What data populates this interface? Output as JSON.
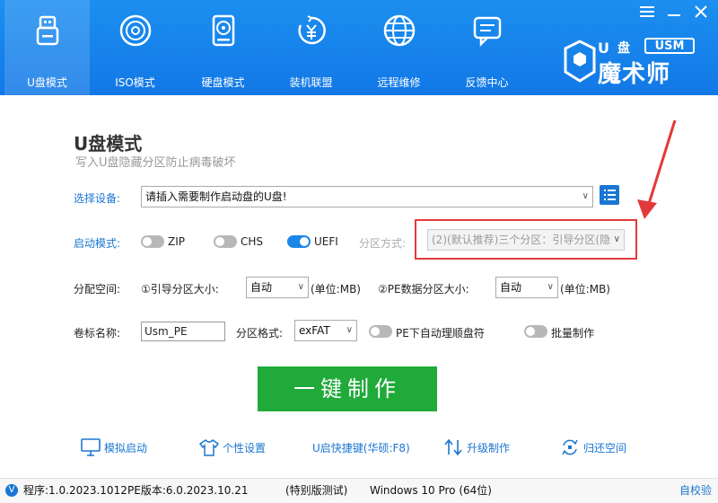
{
  "window": {
    "min_icon": "minimize-icon",
    "menu_icon": "menu-icon",
    "close_icon": "close-icon"
  },
  "nav": [
    {
      "label": "U盘模式",
      "icon": "usb-drive-icon",
      "active": true
    },
    {
      "label": "ISO模式",
      "icon": "disc-icon",
      "active": false
    },
    {
      "label": "硬盘模式",
      "icon": "hard-disk-icon",
      "active": false
    },
    {
      "label": "装机联盟",
      "icon": "yuan-coin-icon",
      "active": false
    },
    {
      "label": "远程维修",
      "icon": "globe-icon",
      "active": false
    },
    {
      "label": "反馈中心",
      "icon": "chat-icon",
      "active": false
    }
  ],
  "brand": {
    "logo_text": "U盘魔术师",
    "badge": "USM"
  },
  "main": {
    "title": "U盘模式",
    "subtitle": "写入U盘隐藏分区防止病毒破坏",
    "device_label": "选择设备:",
    "device_value": "请插入需要制作启动盘的U盘!",
    "boot_label": "启动模式:",
    "boot_options": [
      {
        "label": "ZIP",
        "on": false
      },
      {
        "label": "CHS",
        "on": false
      },
      {
        "label": "UEFI",
        "on": true
      }
    ],
    "partition_label": "分区方式:",
    "partition_value": "(2)(默认推荐)三个分区：引导分区(隐",
    "alloc_label": "分配空间:",
    "boot_part_label": "①引导分区大小:",
    "boot_part_value": "自动",
    "boot_part_unit": "(单位:MB)",
    "pe_part_label": "②PE数据分区大小:",
    "pe_part_value": "自动",
    "pe_part_unit": "(单位:MB)",
    "volume_label": "卷标名称:",
    "volume_value": "Usm_PE",
    "format_label": "分区格式:",
    "format_value": "exFAT",
    "pe_auto_label": "PE下自动理顺盘符",
    "batch_label": "批量制作",
    "make_button": "一键制作"
  },
  "tools": [
    {
      "label": "模拟启动",
      "icon": "monitor-icon"
    },
    {
      "label": "个性设置",
      "icon": "shirt-icon"
    },
    {
      "label": "U启快捷键(华硕:F8)",
      "icon": ""
    },
    {
      "label": "升级制作",
      "icon": "upgrade-arrows-icon"
    },
    {
      "label": "归还空间",
      "icon": "restore-icon"
    }
  ],
  "footer": {
    "program": "程序:1.0.2023.1012",
    "pe_version": "PE版本:6.0.2023.10.21",
    "edition": "(特别版测试)",
    "os": "Windows 10 Pro (64位)",
    "verify": "自校验"
  },
  "colors": {
    "header_blue": "#1585ec",
    "accent_blue": "#1a76d2",
    "go_green": "#1faa3a",
    "annotation_red": "#e23a3a"
  }
}
